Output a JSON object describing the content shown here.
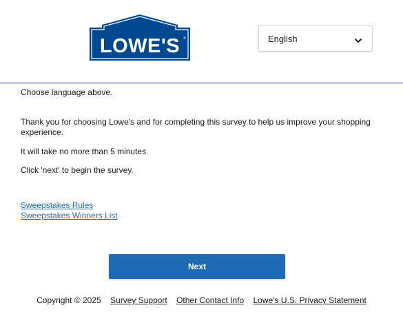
{
  "header": {
    "logo_text": "LOWE'S",
    "language_select": {
      "selected": "English"
    }
  },
  "intro": {
    "choose_language": "Choose language above.",
    "thanks": "Thank you for choosing Lowe's and for completing this survey to help us improve your shopping experience.",
    "time": "It will take no more than 5 minutes.",
    "click_next": "Click 'next' to begin the survey."
  },
  "links": {
    "sweepstakes_rules": "Sweepstakes Rules",
    "sweepstakes_winners": "Sweepstakes Winners List"
  },
  "actions": {
    "next_label": "Next"
  },
  "footer": {
    "copyright": "Copyright © 2025",
    "survey_support": "Survey Support",
    "other_contact": "Other Contact Info",
    "privacy": "Lowe's U.S. Privacy Statement"
  },
  "colors": {
    "brand_blue": "#004990",
    "button_blue": "#1f6bb5",
    "link_blue": "#1f6bb5"
  },
  "icons": {
    "language_dropdown": "chevron-down-icon"
  }
}
